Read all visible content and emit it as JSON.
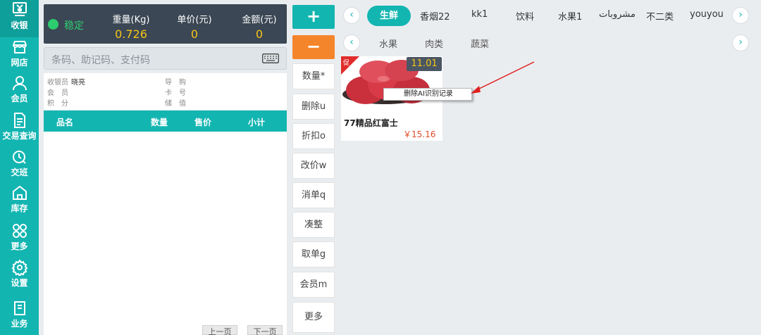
{
  "nav": {
    "items": [
      {
        "label": "收银",
        "icon": "yen-register-icon"
      },
      {
        "label": "网店",
        "icon": "shop-icon"
      },
      {
        "label": "会员",
        "icon": "user-icon"
      },
      {
        "label": "交易查询",
        "icon": "document-icon"
      },
      {
        "label": "交班",
        "icon": "shift-handover-icon"
      },
      {
        "label": "库存",
        "icon": "warehouse-icon"
      },
      {
        "label": "更多",
        "icon": "grid-icon"
      },
      {
        "label": "设置",
        "icon": "gear-icon"
      },
      {
        "label": "业务",
        "icon": "book-icon"
      }
    ]
  },
  "scale": {
    "status": "稳定",
    "weight_label": "重量(Kg)",
    "weight_value": "0.726",
    "unit_price_label": "单价(元)",
    "unit_price_value": "0",
    "amount_label": "金额(元)",
    "amount_value": "0"
  },
  "search": {
    "placeholder": "条码、助记码、支付码"
  },
  "info": {
    "cashier_label": "收银员",
    "cashier_value": "晓亮",
    "guide_label": "导　购",
    "member_label": "会　员",
    "card_label": "卡　号",
    "points_label": "积　分",
    "stored_label": "储　值"
  },
  "table": {
    "headers": [
      "品名",
      "数量",
      "售价",
      "小计"
    ],
    "prev_page": "上一页",
    "next_page": "下一页"
  },
  "actions": {
    "add": "+",
    "minus": "−",
    "buttons": [
      "数量*",
      "删除u",
      "折扣o",
      "改价w",
      "消单q",
      "凑整",
      "取单g",
      "会员m",
      "更多"
    ]
  },
  "categories": [
    "生鲜",
    "香烟22",
    "kk1",
    "饮料",
    "水果1",
    "مشروبات",
    "不二类",
    "youyou"
  ],
  "subcategories": [
    "水果",
    "肉类",
    "蔬菜"
  ],
  "product": {
    "promo": "促",
    "code": "11.01",
    "name": "77精品红富士",
    "price": "￥15.16"
  },
  "context_menu": {
    "item": "删除AI识别记录"
  },
  "colors": {
    "teal": "#13b5b1",
    "orange": "#f5852b",
    "dark": "#3b4754",
    "yellow": "#f5c518",
    "price_red": "#e04a2a",
    "green": "#2ecc71"
  }
}
